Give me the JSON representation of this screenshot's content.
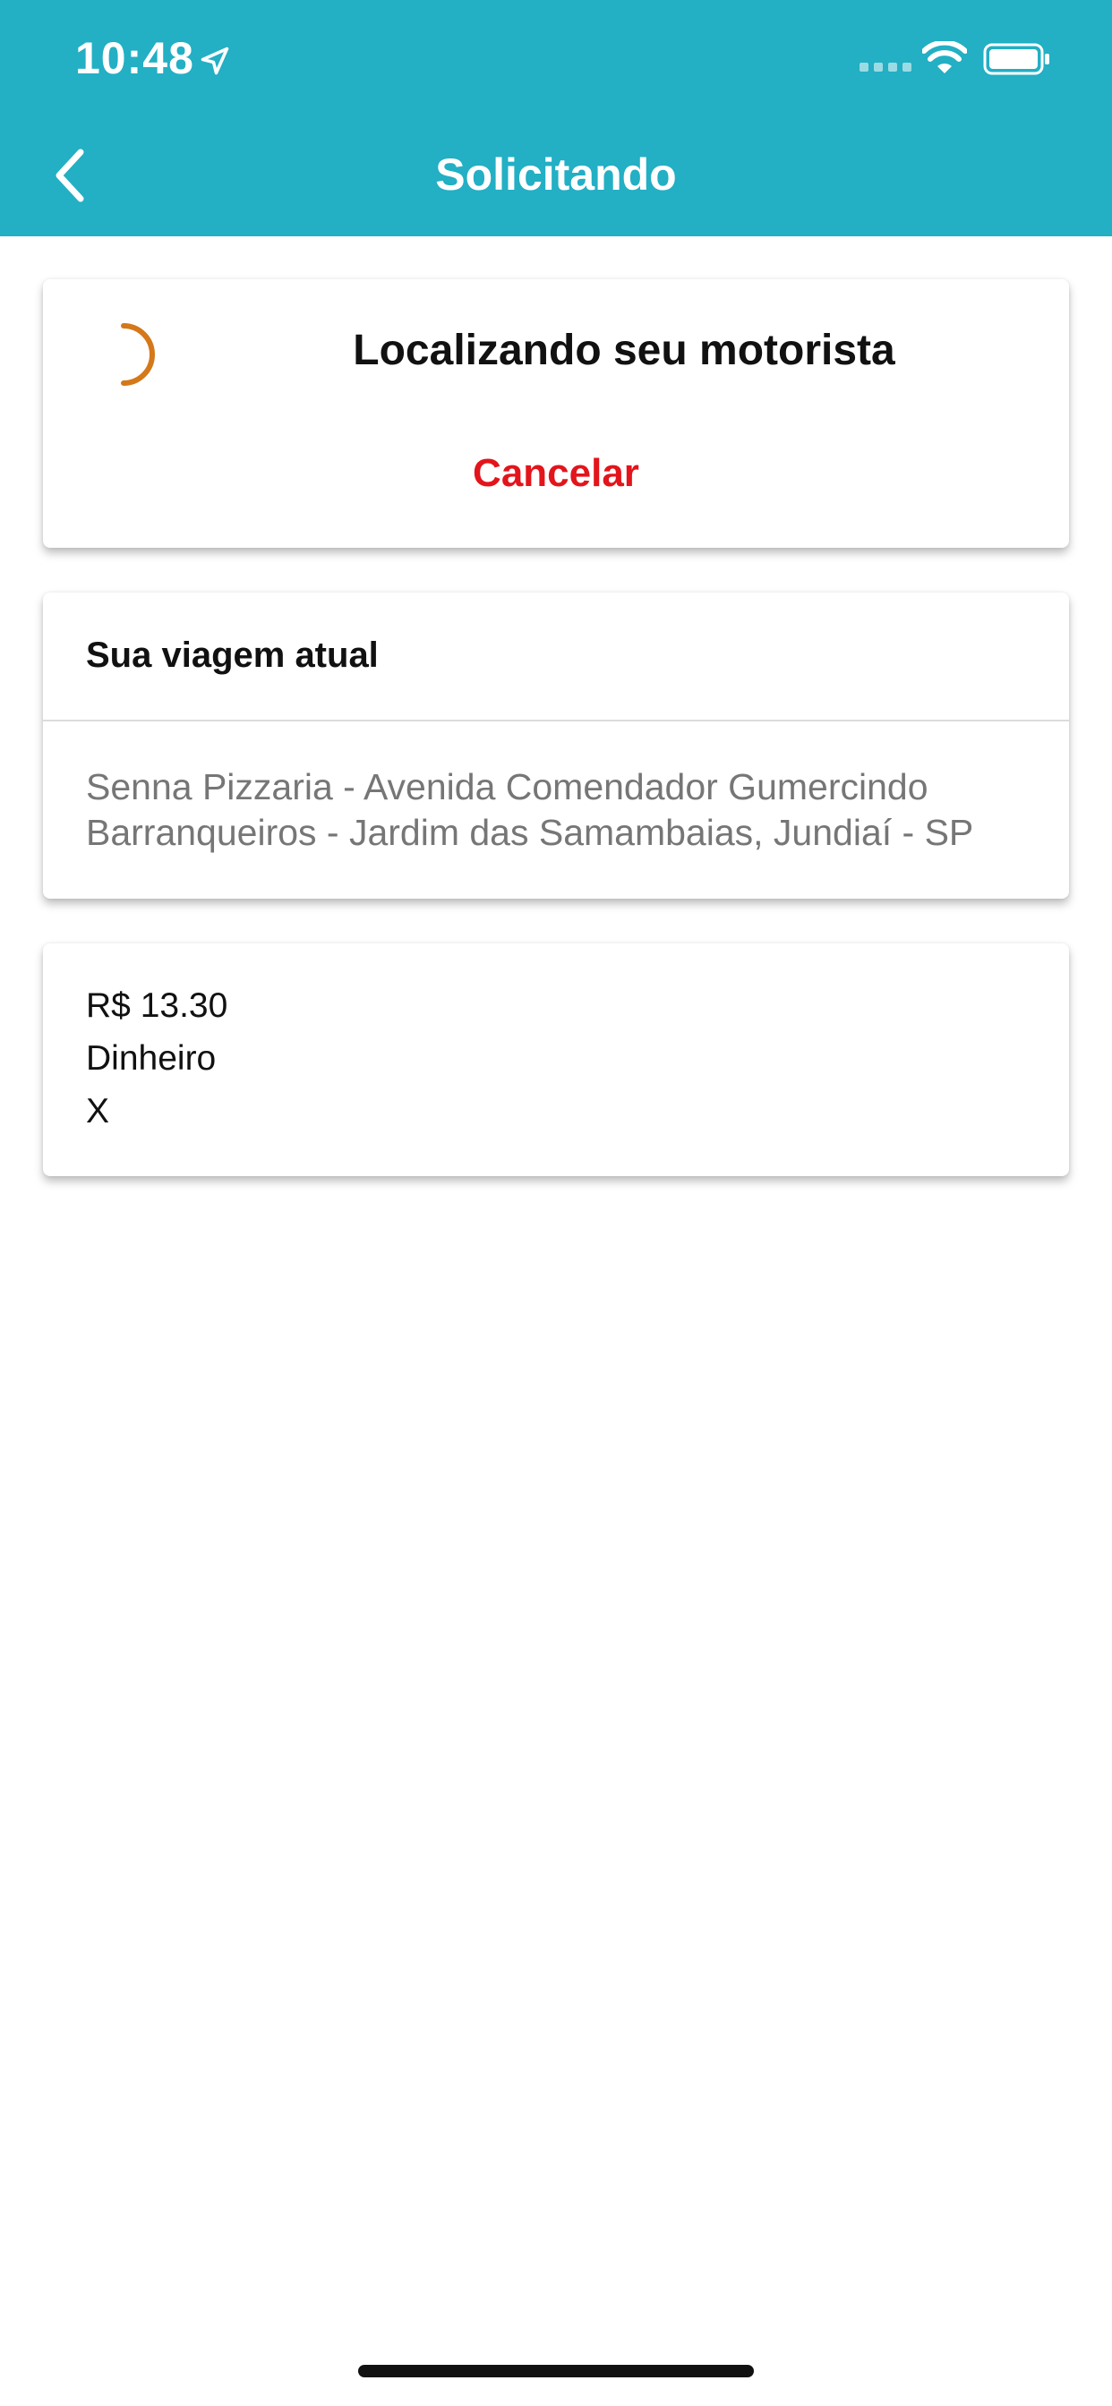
{
  "status_bar": {
    "time": "10:48"
  },
  "header": {
    "title": "Solicitando",
    "background_color": "#23AFC4"
  },
  "status_card": {
    "message": "Localizando seu motorista",
    "cancel_label": "Cancelar",
    "cancel_color": "#E3141B",
    "spinner_color": "#D4781A"
  },
  "trip_card": {
    "heading": "Sua viagem atual",
    "address": "Senna Pizzaria - Avenida Comendador Gumercindo Barranqueiros - Jardim das Samambaias, Jundiaí - SP"
  },
  "payment_card": {
    "price": "R$ 13.30",
    "method": "Dinheiro",
    "extra": "X"
  }
}
